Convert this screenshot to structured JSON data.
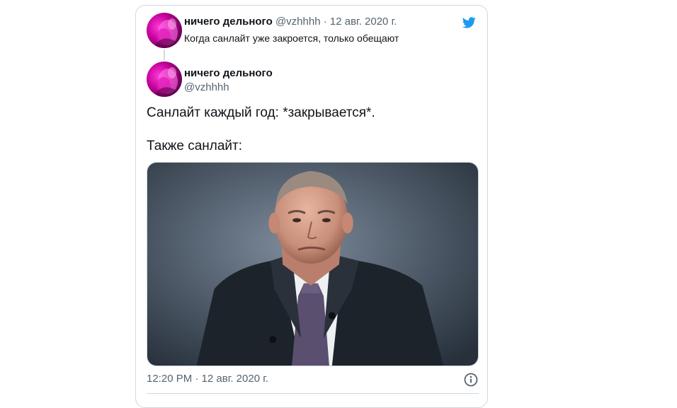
{
  "quoted_tweet": {
    "display_name": "ничего дельного",
    "handle": "@vzhhhh",
    "separator": " · ",
    "date": "12 авг. 2020 г.",
    "text": "Когда санлайт уже закроется, только обещают"
  },
  "main_tweet": {
    "display_name": "ничего дельного",
    "handle": "@vzhhhh",
    "line1": "Санлайт каждый год: *закрывается*.",
    "line2": "Также санлайт:",
    "timestamp": "12:20 PM · 12 авг. 2020 г."
  },
  "icons": {
    "brand": "twitter-bird-icon",
    "info": "info-icon"
  },
  "colors": {
    "twitter_blue": "#1d9bf0",
    "secondary_text": "#536471",
    "border": "#cfd9de",
    "avatar_magenta": "#c9049e"
  }
}
